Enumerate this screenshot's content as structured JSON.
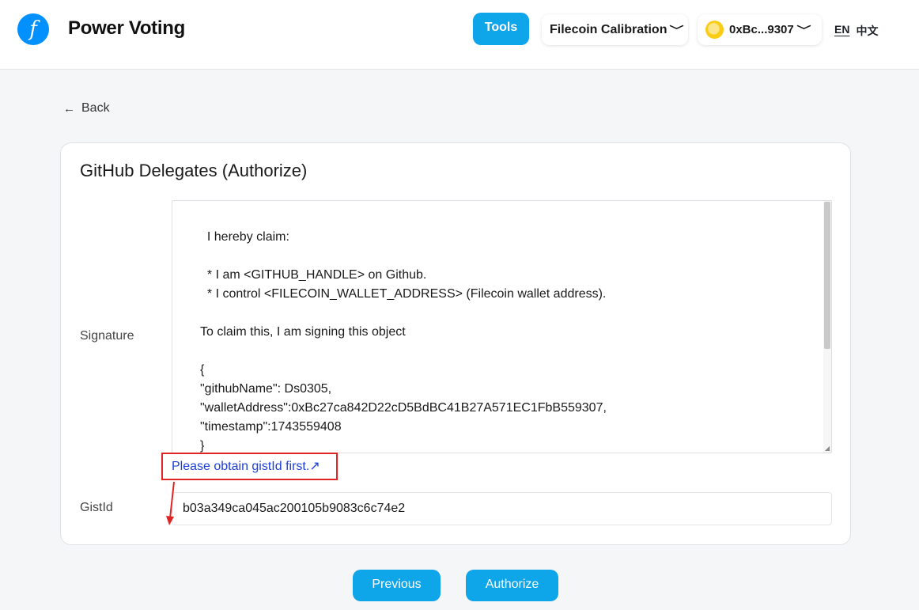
{
  "header": {
    "logo_glyph": "f",
    "app_title": "Power Voting",
    "tools_label": "Tools",
    "network_label": "Filecoin Calibration",
    "wallet_label": "0xBc...9307",
    "lang_en": "EN",
    "lang_zh": "中文"
  },
  "nav": {
    "back_label": "Back"
  },
  "card": {
    "title": "GitHub Delegates (Authorize)",
    "signature_label": "Signature",
    "signature_text": "  I hereby claim:\n\n  * I am <GITHUB_HANDLE> on Github.\n  * I control <FILECOIN_WALLET_ADDRESS> (Filecoin wallet address).\n\nTo claim this, I am signing this object\n\n{\n\"githubName\": Ds0305,\n\"walletAddress\":0xBc27ca842D22cD5BdBC41B27A571EC1FbB559307,\n\"timestamp\":1743559408\n}",
    "gist_link_text": "Please obtain gistId first.↗",
    "gist_label": "GistId",
    "gist_value": "b03a349ca045ac200105b9083c6c74e2"
  },
  "footer": {
    "previous_label": "Previous",
    "authorize_label": "Authorize"
  },
  "colors": {
    "accent": "#0ea5e9",
    "logo": "#0090ff",
    "link": "#1d3fd8",
    "annotation": "#e02424"
  },
  "icons": {
    "logo": "filecoin-logo",
    "back": "arrow-left-icon",
    "dropdown": "chevron-down-icon",
    "wallet_avatar": "wallet-avatar"
  }
}
